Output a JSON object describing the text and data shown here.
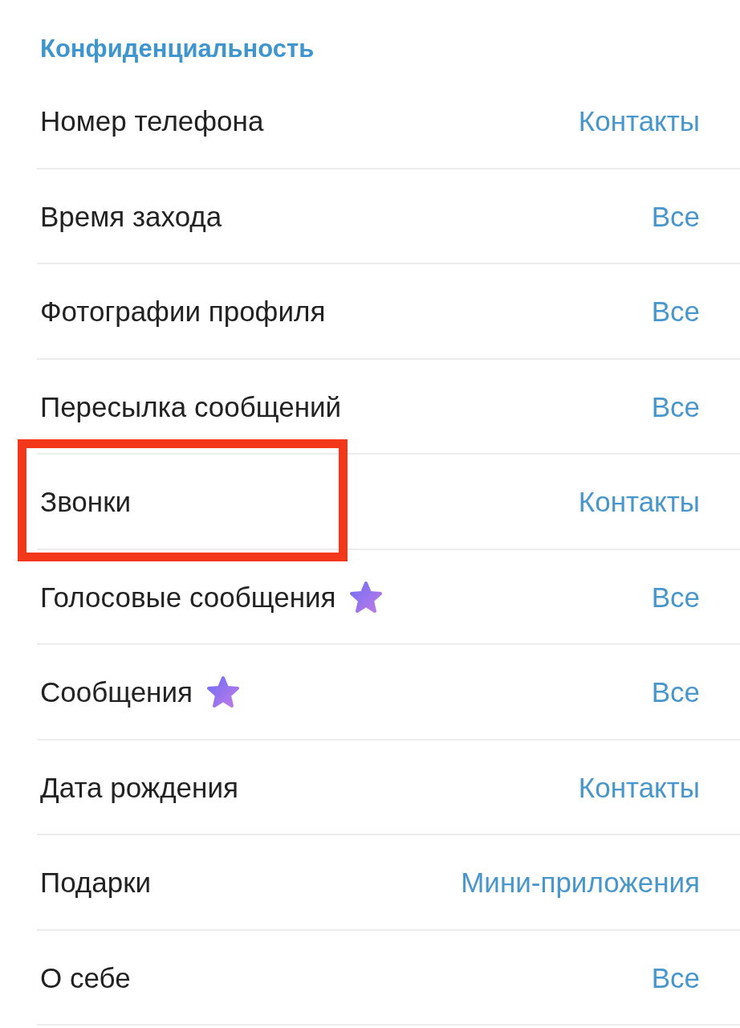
{
  "section_title": "Конфиденциальность",
  "rows": [
    {
      "label": "Номер телефона",
      "value": "Контакты",
      "premium": false,
      "highlighted": false
    },
    {
      "label": "Время захода",
      "value": "Все",
      "premium": false,
      "highlighted": false
    },
    {
      "label": "Фотографии профиля",
      "value": "Все",
      "premium": false,
      "highlighted": false
    },
    {
      "label": "Пересылка сообщений",
      "value": "Все",
      "premium": false,
      "highlighted": false
    },
    {
      "label": "Звонки",
      "value": "Контакты",
      "premium": false,
      "highlighted": true
    },
    {
      "label": "Голосовые сообщения",
      "value": "Все",
      "premium": true,
      "highlighted": false
    },
    {
      "label": "Сообщения",
      "value": "Все",
      "premium": true,
      "highlighted": false
    },
    {
      "label": "Дата рождения",
      "value": "Контакты",
      "premium": false,
      "highlighted": false
    },
    {
      "label": "Подарки",
      "value": "Мини-приложения",
      "premium": false,
      "highlighted": false
    },
    {
      "label": "О себе",
      "value": "Все",
      "premium": false,
      "highlighted": false
    }
  ]
}
